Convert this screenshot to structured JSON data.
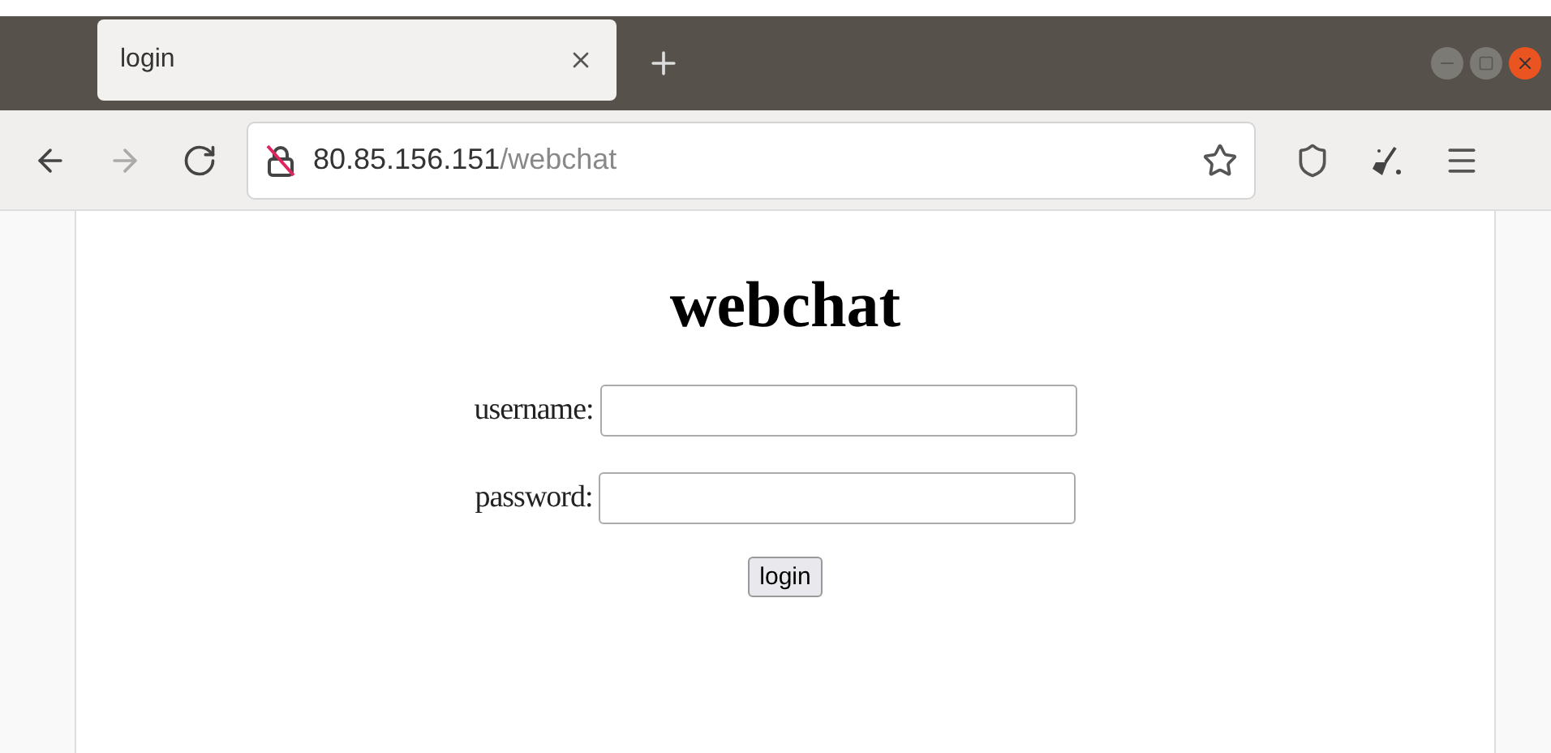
{
  "tabs": [
    {
      "label": "login",
      "selected": true
    }
  ],
  "navigation": [
    {
      "kind": "back",
      "disabled": false
    },
    {
      "kind": "forward",
      "disabled": true
    },
    {
      "kind": "reload",
      "disabled": false
    }
  ],
  "address": {
    "host": "80.85.156.151",
    "path": "/webchat",
    "insecure": true
  },
  "page": {
    "heading": "webchat",
    "fields": [
      {
        "label": "username:"
      },
      {
        "label": "password:"
      }
    ],
    "button": "login"
  }
}
